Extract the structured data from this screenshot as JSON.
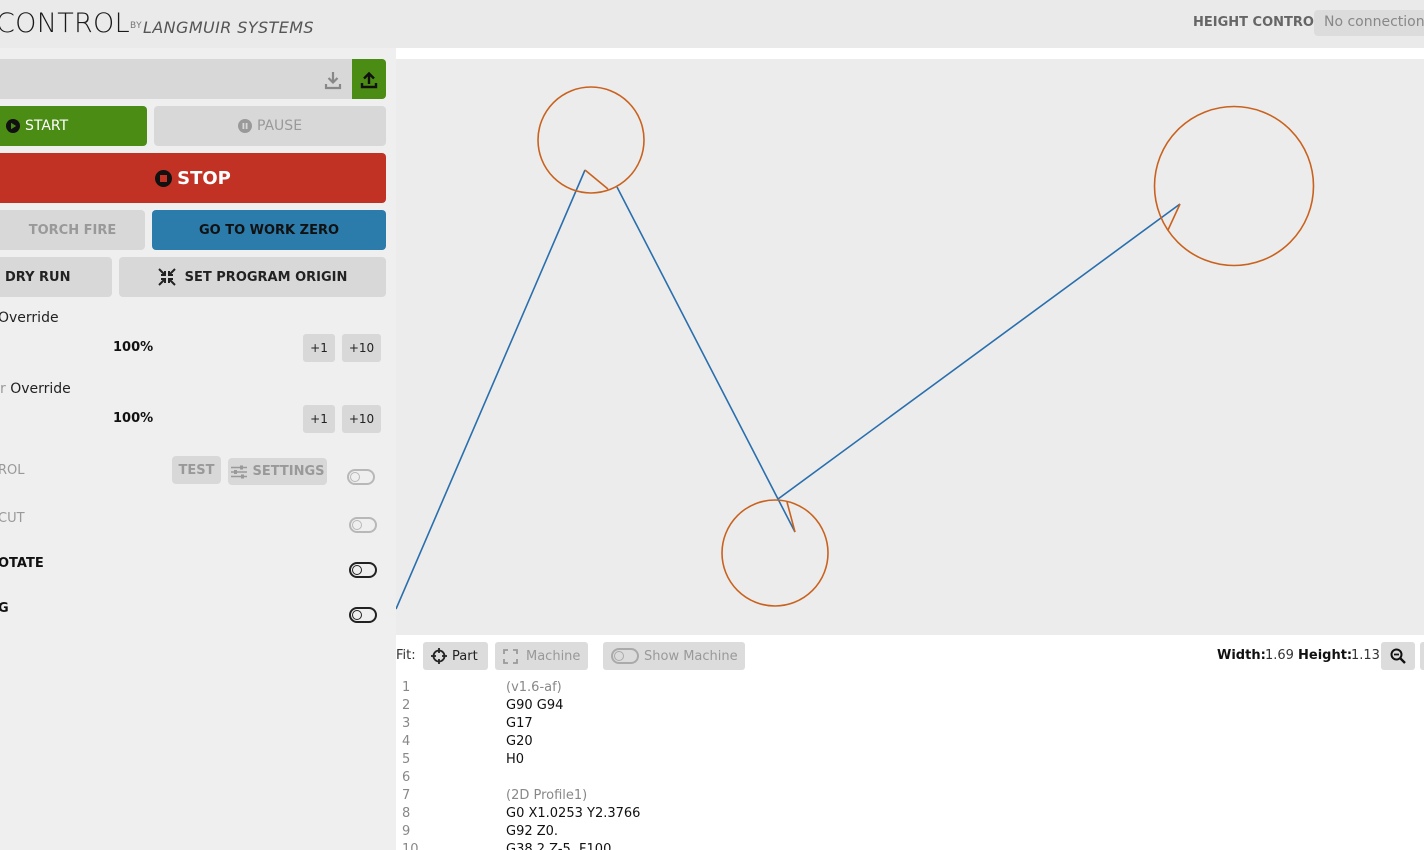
{
  "header": {
    "title": "CONTROL",
    "by": "BY",
    "brand": "LANGMUIR SYSTEMS",
    "height_control_label": "HEIGHT CONTROL:",
    "height_control_status": "No connections"
  },
  "controls": {
    "start_label": "START",
    "pause_label": "PAUSE",
    "stop_label": "STOP",
    "torch_fire_label": "TORCH FIRE",
    "work_zero_label": "GO TO WORK ZERO",
    "dry_run_label": "DRY RUN",
    "set_origin_label": "SET PROGRAM ORIGIN"
  },
  "overrides": [
    {
      "label": "Override",
      "value": "100%",
      "step_small": "+1",
      "step_large": "+10"
    },
    {
      "label": "Override",
      "value": "100%",
      "step_small": "+1",
      "step_large": "+10"
    }
  ],
  "settings_rows": {
    "thc_label": "ROL",
    "test_label": "TEST",
    "settings_label": "SETTINGS",
    "cut_label": "CUT",
    "rotate_label": "OTATE",
    "last_label": "G"
  },
  "toolbar": {
    "fit_label": "Fit:",
    "part_label": "Part",
    "machine_label": "Machine",
    "show_machine_label": "Show Machine",
    "width_label": "Width:",
    "width_value": "1.69",
    "height_label": "Height:",
    "height_value": "1.13"
  },
  "gcode": [
    {
      "num": "1",
      "text": "(v1.6-af)",
      "comment": true
    },
    {
      "num": "2",
      "text": "G90 G94",
      "comment": false
    },
    {
      "num": "3",
      "text": "G17",
      "comment": false
    },
    {
      "num": "4",
      "text": "G20",
      "comment": false
    },
    {
      "num": "5",
      "text": "H0",
      "comment": false
    },
    {
      "num": "6",
      "text": "",
      "comment": false
    },
    {
      "num": "7",
      "text": "(2D Profile1)",
      "comment": true
    },
    {
      "num": "8",
      "text": "G0 X1.0253 Y2.3766",
      "comment": false
    },
    {
      "num": "9",
      "text": "G92 Z0.",
      "comment": false
    },
    {
      "num": "10",
      "text": "G38.2 Z-5. F100",
      "comment": false
    }
  ],
  "colors": {
    "start_green": "#4b8c15",
    "stop_red": "#c13224",
    "work_zero_blue": "#2b7bab",
    "cut_path": "#c9621e",
    "rapid_path": "#2a6fad"
  }
}
